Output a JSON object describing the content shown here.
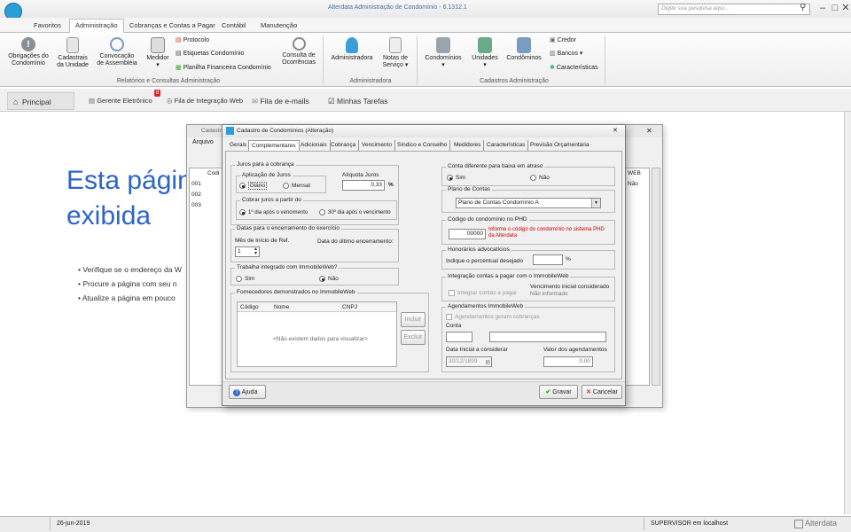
{
  "app": {
    "title": "Alterdata Administração de Condomínio - 6.1312.1",
    "search_placeholder": "Digite sua pesquisa aqui..."
  },
  "ribbon_tabs": [
    "Favoritos",
    "Administração",
    "Cobranças e Contas a Pagar",
    "Contábil",
    "Manutenção"
  ],
  "ribbon": {
    "g1": {
      "label": "Relatórios e Consultas Administração",
      "buttons": [
        "Obrigações do\nCondomínio",
        "Cadastrais\nda Unidade",
        "Convocação\nde Assembléia",
        "Medidor\n▾",
        "Consulta de\nOcorrências"
      ],
      "small": [
        "Protocolo",
        "Etiquetas Condomínio",
        "Planilha Financeira Condomínio"
      ]
    },
    "g2": {
      "label": "Administradora",
      "buttons": [
        "Administradora",
        "Notas de\nServiço ▾"
      ]
    },
    "g3": {
      "label": "Cadastros Administração",
      "buttons": [
        "Condomínios\n▾",
        "Unidades\n▾",
        "Condôminos"
      ],
      "small": [
        "Credor",
        "Bancos ▾",
        "Características"
      ]
    }
  },
  "tabbar": {
    "principal": "Principal",
    "gerente": "Gerente Eletrônico",
    "badge": "8",
    "integracao": "Fila de Integração Web",
    "emails": "Fila de e-mails",
    "tarefas": "Minhas Tarefas"
  },
  "bg_page": {
    "title1": "Esta página",
    "title2": "exibida",
    "bullets": [
      "Verifique se o endereço da W",
      "Procure a página com seu n",
      "Atualize a página em pouco"
    ]
  },
  "back_window": {
    "title": "Cadastr",
    "menu": "Arquivo",
    "col1": "Códi",
    "col2": "WEB",
    "rows": [
      {
        "code": "001",
        "web": "Não"
      },
      {
        "code": "002",
        "web": ""
      },
      {
        "code": "003",
        "web": ""
      }
    ]
  },
  "dialog": {
    "title": "Cadastro de Condomínios (Alteração)",
    "close": "✕",
    "tabs": [
      "Gerais",
      "Complementares",
      "Adicionais",
      "Cobrança",
      "Vencimento",
      "Síndico e Conselho",
      "Medidores",
      "Características",
      "Previsão Orçamentária"
    ],
    "juros": {
      "legend": "Juros para a cobrança",
      "aplicacao": "Aplicação de Juros",
      "diario": "Diário",
      "mensal": "Mensal",
      "aliquota_label": "Alíquota Juros",
      "aliquota": "0,33",
      "pct": "%",
      "cobrar_legend": "Cobrar juros a partir do",
      "opt1": "1º dia após o vencimento",
      "opt2": "30º dia após o vencimento"
    },
    "datas": {
      "legend": "Datas para o encerramento do exercício",
      "mes_label": "Mês de Início de Ref.",
      "mes": "1",
      "ultimo": "Data do último encerramento:"
    },
    "immobile": {
      "legend": "Trabalha integrado com ImmobileWeb?",
      "sim": "Sim",
      "nao": "Não"
    },
    "fornecedores": {
      "legend": "Fornecedores demonstrados no ImmobileWeb",
      "cols": [
        "Código",
        "Nome",
        "CNPJ"
      ],
      "empty": "<Não existem dados para visualizar>",
      "incluir": "Incluir",
      "excluir": "Excluir"
    },
    "conta_diff": {
      "legend": "Conta diferente para baixa em atraso",
      "sim": "Sim",
      "nao": "Não"
    },
    "plano": {
      "legend": "Plano de Contas",
      "value": "Plano de Contas Condomínio A"
    },
    "phd": {
      "legend": "Código do condomínio no PHD",
      "value": "00000",
      "hint": "Informe o código do condomínio no sistema PHD da Alterdata"
    },
    "honor": {
      "legend": "Honorários advocatícios",
      "label": "Indique o percentual desejado",
      "pct": "%"
    },
    "integr": {
      "legend": "Integração contas a pagar com o ImmobileWeb",
      "chk": "Integrar contas a pagar",
      "venc_label": "Vencimento inicial considerado",
      "venc_val": "Não informado"
    },
    "agend": {
      "legend": "Agendamentos ImmobileWeb",
      "chk": "Agendamentos geram cobranças",
      "conta": "Conta",
      "data_label": "Data Inicial a considerar",
      "data": "30/12/1899",
      "valor_label": "Valor dos agendamentos",
      "valor": "0,00"
    },
    "ajuda": "Ajuda",
    "gravar": "Gravar",
    "cancelar": "Cancelar"
  },
  "status": {
    "date": "26-jun-2019",
    "user": "SUPERVISOR em localhost",
    "brand": "Alterdata"
  }
}
